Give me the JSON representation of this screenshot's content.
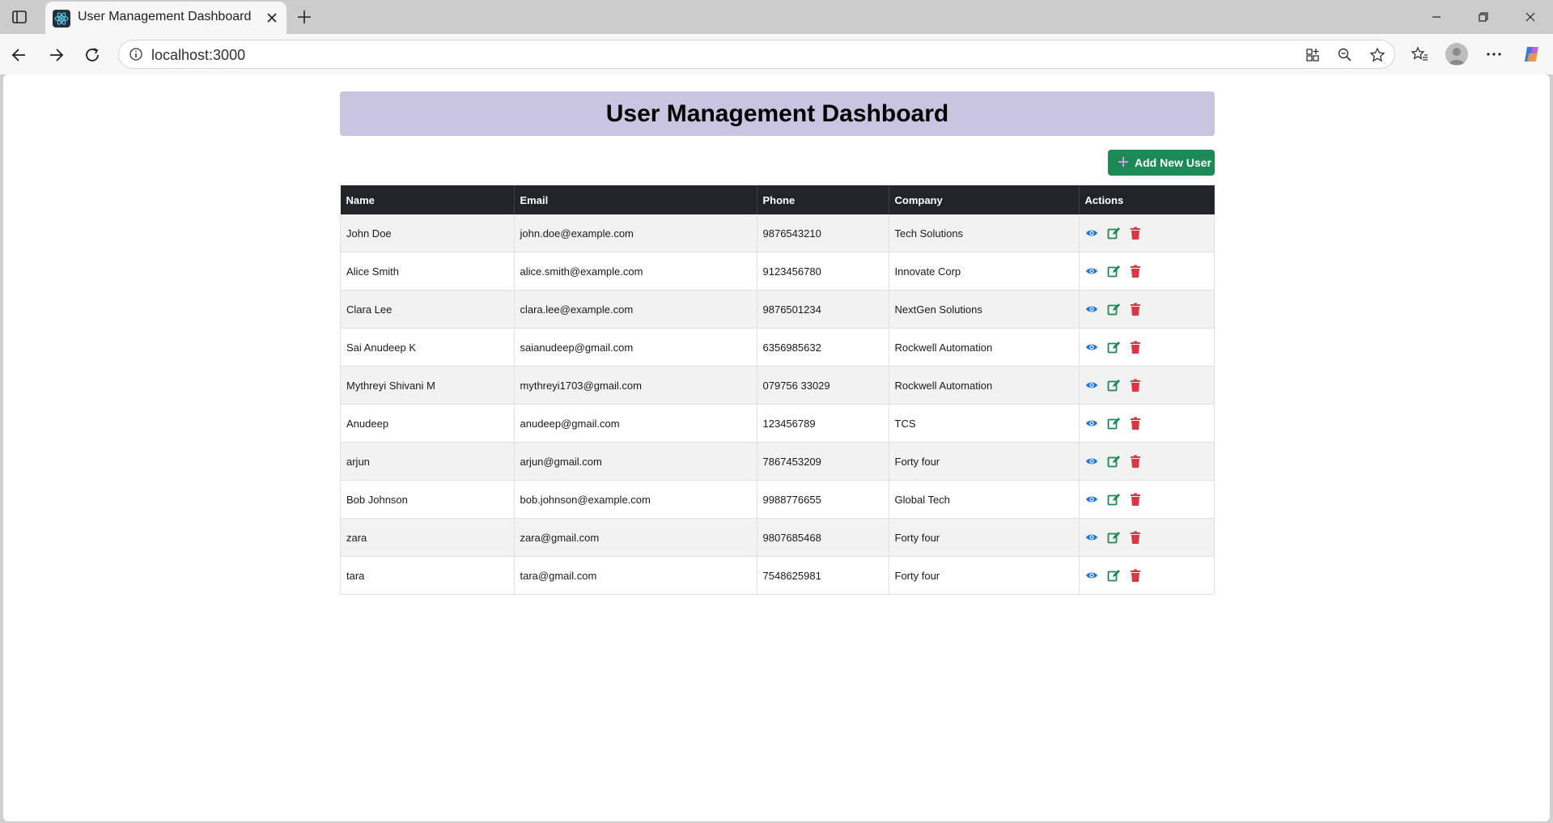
{
  "browser": {
    "tab_title": "User Management Dashboard",
    "url": "localhost:3000"
  },
  "page": {
    "title": "User Management Dashboard",
    "add_button_label": "Add New User"
  },
  "table": {
    "headers": [
      "Name",
      "Email",
      "Phone",
      "Company",
      "Actions"
    ],
    "rows": [
      {
        "name": "John Doe",
        "email": "john.doe@example.com",
        "phone": "9876543210",
        "company": "Tech Solutions"
      },
      {
        "name": "Alice Smith",
        "email": "alice.smith@example.com",
        "phone": "9123456780",
        "company": "Innovate Corp"
      },
      {
        "name": "Clara Lee",
        "email": "clara.lee@example.com",
        "phone": "9876501234",
        "company": "NextGen Solutions"
      },
      {
        "name": "Sai Anudeep K",
        "email": "saianudeep@gmail.com",
        "phone": "6356985632",
        "company": "Rockwell Automation"
      },
      {
        "name": "Mythreyi Shivani M",
        "email": "mythreyi1703@gmail.com",
        "phone": "079756 33029",
        "company": "Rockwell Automation"
      },
      {
        "name": "Anudeep",
        "email": "anudeep@gmail.com",
        "phone": "123456789",
        "company": "TCS"
      },
      {
        "name": "arjun",
        "email": "arjun@gmail.com",
        "phone": "7867453209",
        "company": "Forty four"
      },
      {
        "name": "Bob Johnson",
        "email": "bob.johnson@example.com",
        "phone": "9988776655",
        "company": "Global Tech"
      },
      {
        "name": "zara",
        "email": "zara@gmail.com",
        "phone": "9807685468",
        "company": "Forty four"
      },
      {
        "name": "tara",
        "email": "tara@gmail.com",
        "phone": "7548625981",
        "company": "Forty four"
      }
    ],
    "actions": [
      "view-icon",
      "edit-icon",
      "delete-icon"
    ]
  },
  "colors": {
    "header_bg": "#c9c5e1",
    "table_header_bg": "#212529",
    "add_button_bg": "#1c8a56",
    "view_icon": "#1a73e8",
    "edit_icon": "#1c8a56",
    "delete_icon": "#dc3545"
  }
}
